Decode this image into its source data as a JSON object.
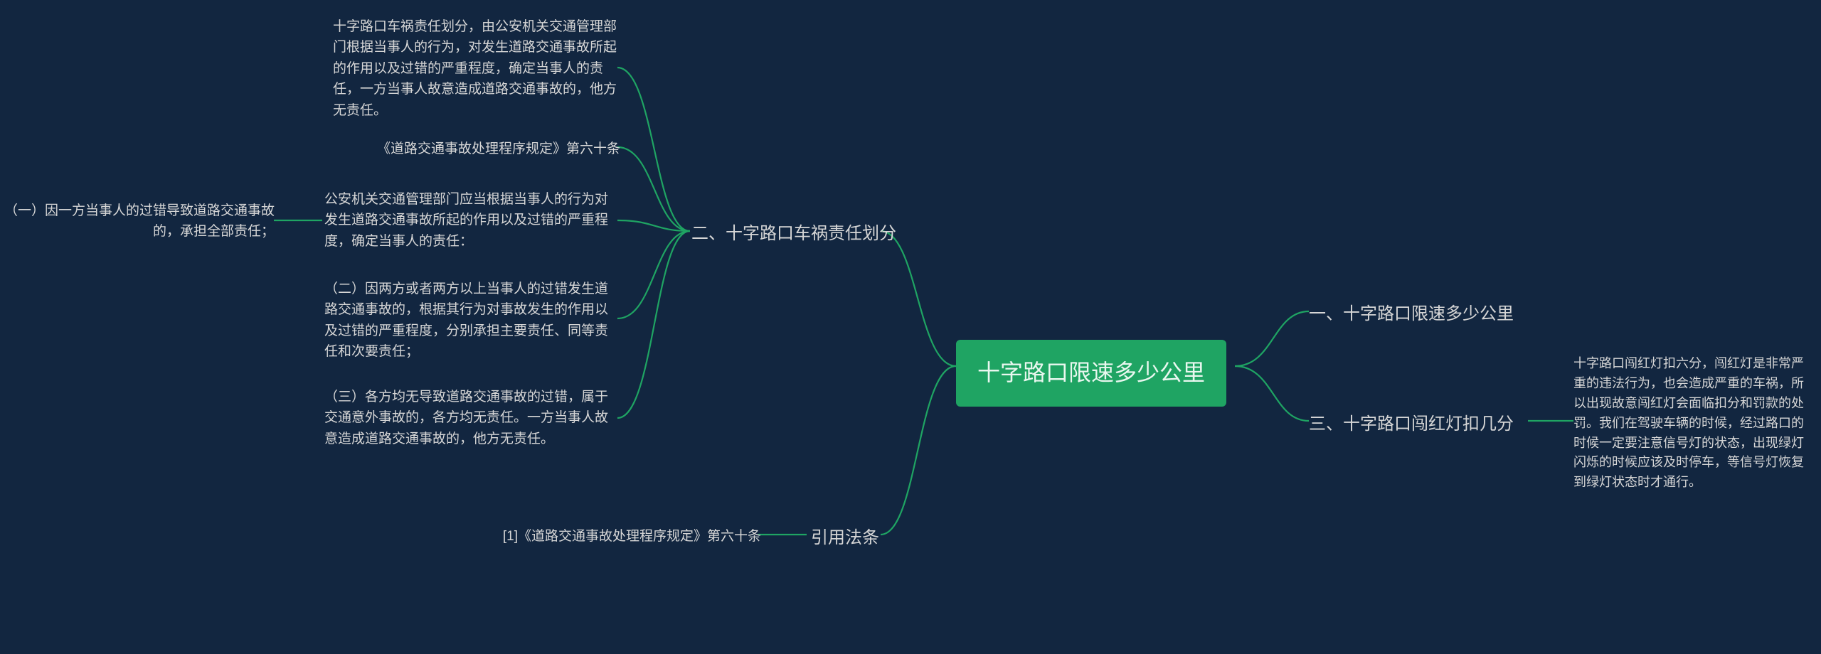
{
  "root": {
    "title": "十字路口限速多少公里"
  },
  "right": {
    "branch1": {
      "label": "一、十字路口限速多少公里"
    },
    "branch3": {
      "label": "三、十字路口闯红灯扣几分",
      "leaf": "十字路口闯红灯扣六分，闯红灯是非常严重的违法行为，也会造成严重的车祸，所以出现故意闯红灯会面临扣分和罚款的处罚。我们在驾驶车辆的时候，经过路口的时候一定要注意信号灯的状态，出现绿灯闪烁的时候应该及时停车，等信号灯恢复到绿灯状态时才通行。"
    }
  },
  "left": {
    "branch2": {
      "label": "二、十字路口车祸责任划分",
      "leaves": {
        "a": "十字路口车祸责任划分，由公安机关交通管理部门根据当事人的行为，对发生道路交通事故所起的作用以及过错的严重程度，确定当事人的责任，一方当事人故意造成道路交通事故的，他方无责任。",
        "b": "《道路交通事故处理程序规定》第六十条",
        "c": {
          "text": "公安机关交通管理部门应当根据当事人的行为对发生道路交通事故所起的作用以及过错的严重程度，确定当事人的责任：",
          "sub": "（一）因一方当事人的过错导致道路交通事故的，承担全部责任；"
        },
        "d": "（二）因两方或者两方以上当事人的过错发生道路交通事故的，根据其行为对事故发生的作用以及过错的严重程度，分别承担主要责任、同等责任和次要责任；",
        "e": "（三）各方均无导致道路交通事故的过错，属于交通意外事故的，各方均无责任。一方当事人故意造成道路交通事故的，他方无责任。"
      }
    },
    "branch4": {
      "label": "引用法条",
      "leaf": "[1]《道路交通事故处理程序规定》第六十条"
    }
  }
}
